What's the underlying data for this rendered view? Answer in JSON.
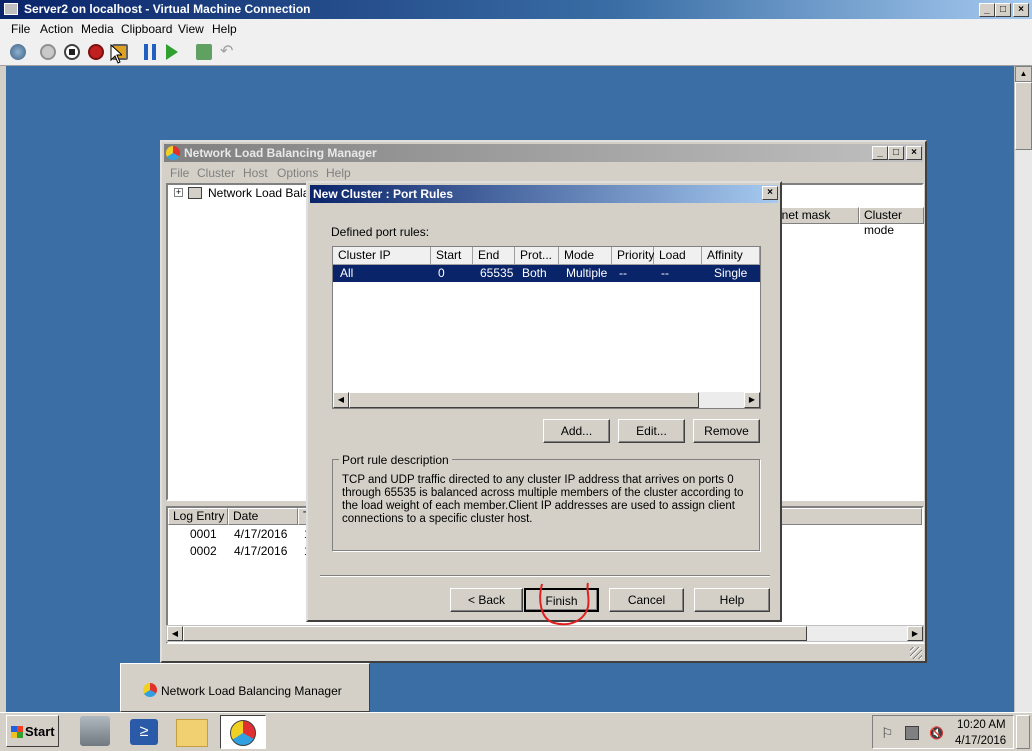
{
  "vm": {
    "title": "Server2 on localhost - Virtual Machine Connection",
    "menu": [
      "File",
      "Action",
      "Media",
      "Clipboard",
      "View",
      "Help"
    ],
    "toolbar_icons": [
      "ctrl-alt-del-icon",
      "start-icon",
      "turn-off-icon",
      "shutdown-icon",
      "save-icon",
      "pause-icon",
      "resume-icon",
      "snapshot-icon",
      "revert-icon"
    ]
  },
  "nlb": {
    "title": "Network Load Balancing Manager",
    "menu": [
      "File",
      "Cluster",
      "Host",
      "Options",
      "Help"
    ],
    "tree_root": "Network Load Balanc",
    "cluster_columns": [
      "bnet mask",
      "Cluster mode"
    ],
    "log_columns": [
      "Log Entry",
      "Date",
      "T"
    ],
    "log_rows": [
      {
        "entry": "0001",
        "date": "4/17/2016",
        "t": "1"
      },
      {
        "entry": "0002",
        "date": "4/17/2016",
        "t": "1"
      }
    ]
  },
  "dialog": {
    "title": "New Cluster : Port Rules",
    "defined_label": "Defined port rules:",
    "columns": [
      "Cluster IP address",
      "Start",
      "End",
      "Prot...",
      "Mode",
      "Priority",
      "Load",
      "Affinity"
    ],
    "rows": [
      {
        "ip": "All",
        "start": "0",
        "end": "65535",
        "prot": "Both",
        "mode": "Multiple",
        "priority": "--",
        "load": "--",
        "affinity": "Single"
      }
    ],
    "add_label": "Add...",
    "edit_label": "Edit...",
    "remove_label": "Remove",
    "desc_legend": "Port rule description",
    "desc_text": "TCP and UDP traffic directed to any cluster IP address that arrives on ports 0 through 65535 is balanced across multiple members of the cluster according to the load weight of each member.Client IP addresses are used to assign client connections to a specific cluster host.",
    "back_label": "< Back",
    "finish_label": "Finish",
    "cancel_label": "Cancel",
    "help_label": "Help"
  },
  "taskbar": {
    "start_label": "Start",
    "popup_label": "Network Load Balancing Manager",
    "time": "10:20 AM",
    "date": "4/17/2016"
  }
}
